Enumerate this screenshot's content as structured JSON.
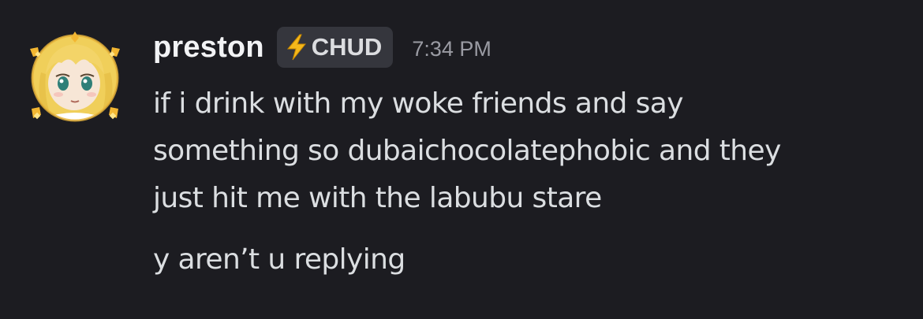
{
  "message": {
    "author": {
      "username": "preston",
      "avatar_icon": "anime-girl-avatar-icon",
      "avatar_decoration": "gold-sparkle-frame"
    },
    "tag": {
      "icon": "lightning-bolt-icon",
      "label": "CHUD",
      "icon_color": "#f5b81b"
    },
    "timestamp": "7:34 PM",
    "lines": [
      "if i drink with my woke friends and say",
      "something so dubaichocolatephobic and they",
      "just hit me with the labubu stare"
    ]
  },
  "followup_message": {
    "text": "y aren’t u replying"
  },
  "colors": {
    "background": "#1c1c21",
    "username": "#f2f3f5",
    "text": "#dbdee1",
    "timestamp": "#9a9ba3",
    "tag_background": "#35363d"
  }
}
